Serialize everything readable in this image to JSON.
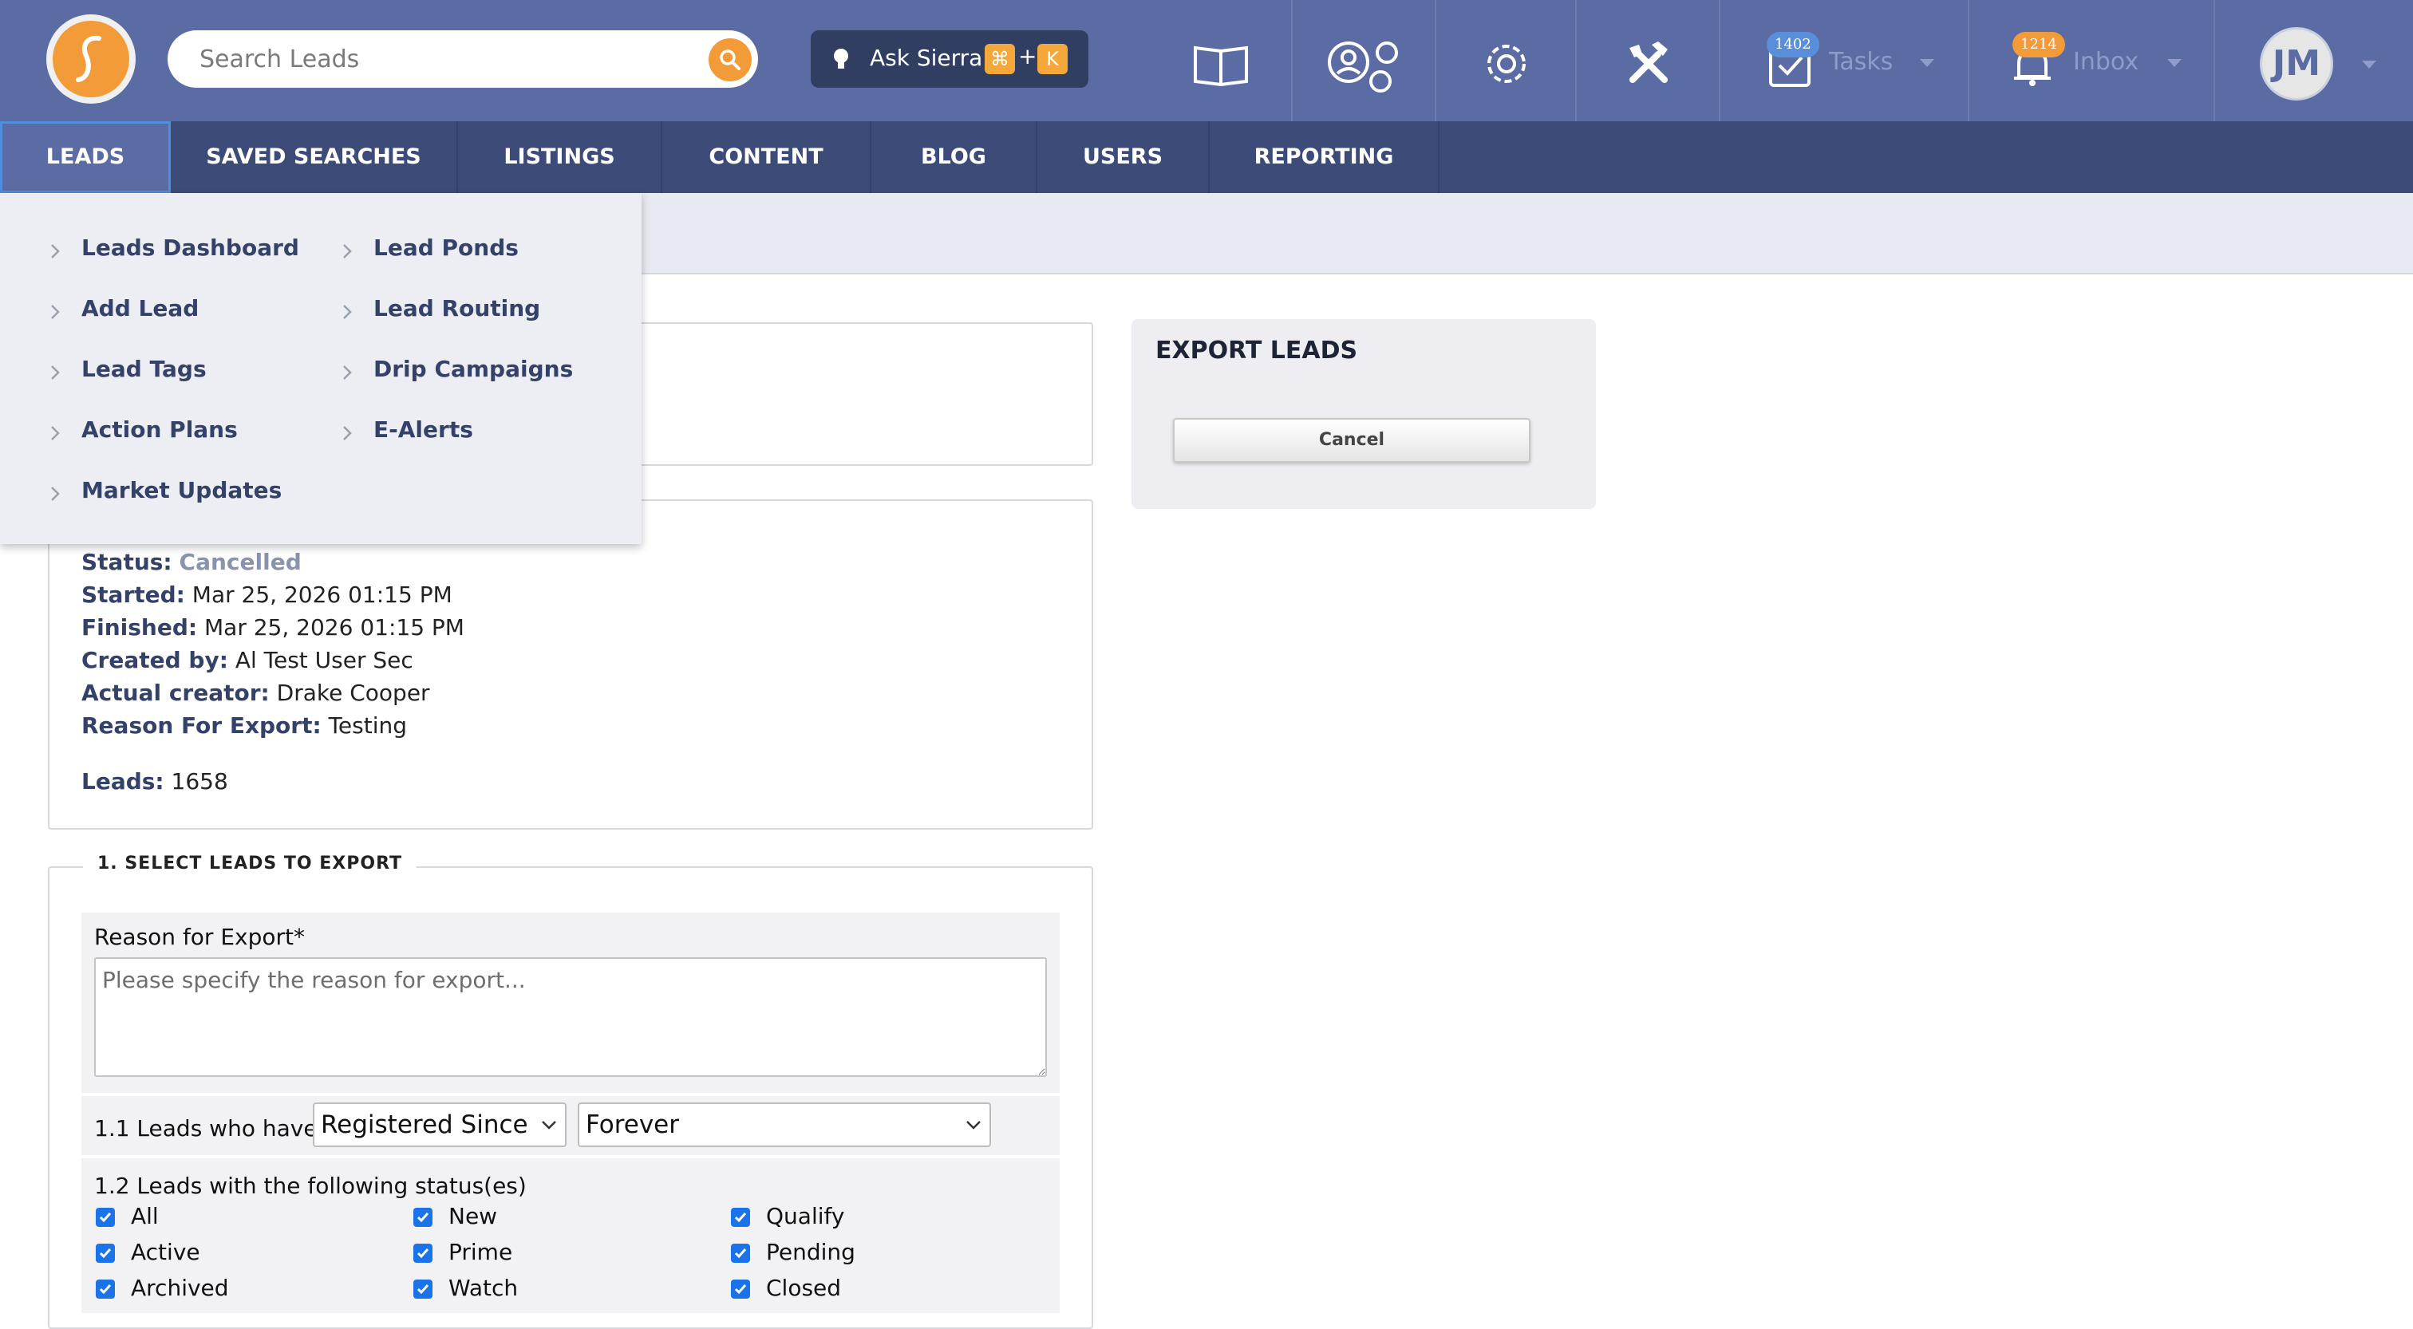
{
  "search": {
    "placeholder": "Search Leads"
  },
  "ask": {
    "label": "Ask Sierra",
    "shortcut_cmd": "⌘",
    "shortcut_plus": "+",
    "shortcut_key": "K"
  },
  "tasks": {
    "label": "Tasks",
    "count": "1402"
  },
  "inbox": {
    "label": "Inbox",
    "count": "1214"
  },
  "user": {
    "initials": "JM"
  },
  "nav": {
    "items": [
      {
        "label": "LEADS"
      },
      {
        "label": "SAVED SEARCHES"
      },
      {
        "label": "LISTINGS"
      },
      {
        "label": "CONTENT"
      },
      {
        "label": "BLOG"
      },
      {
        "label": "USERS"
      },
      {
        "label": "REPORTING"
      }
    ]
  },
  "leads_menu": {
    "col1": [
      "Leads Dashboard",
      "Add Lead",
      "Lead Tags",
      "Action Plans",
      "Market Updates"
    ],
    "col2": [
      "Lead Ponds",
      "Lead Routing",
      "Drip Campaigns",
      "E-Alerts"
    ]
  },
  "export_info": {
    "status_label": "Status:",
    "status_value": "Cancelled",
    "started_label": "Started:",
    "started_value": "Mar 25, 2026 01:15 PM",
    "finished_label": "Finished:",
    "finished_value": "Mar 25, 2026 01:15 PM",
    "created_label": "Created by:",
    "created_value": "Al Test User Sec",
    "creator_label": "Actual creator:",
    "creator_value": "Drake Cooper",
    "reason_label": "Reason For Export:",
    "reason_value": "Testing",
    "leads_label": "Leads:",
    "leads_value": "1658"
  },
  "export_panel": {
    "title": "EXPORT LEADS",
    "cancel_label": "Cancel"
  },
  "select_section": {
    "legend": "1. SELECT LEADS TO EXPORT",
    "reason_label": "Reason for Export*",
    "reason_placeholder": "Please specify the reason for export...",
    "row11_label": "1.1 Leads who have",
    "select1_value": "Registered Since",
    "select2_value": "Forever",
    "row12_label": "1.2 Leads with the following status(es)",
    "statuses": [
      {
        "label": "All",
        "checked": true
      },
      {
        "label": "New",
        "checked": true
      },
      {
        "label": "Qualify",
        "checked": true
      },
      {
        "label": "Active",
        "checked": true
      },
      {
        "label": "Prime",
        "checked": true
      },
      {
        "label": "Pending",
        "checked": true
      },
      {
        "label": "Archived",
        "checked": true
      },
      {
        "label": "Watch",
        "checked": true
      },
      {
        "label": "Closed",
        "checked": true
      }
    ]
  },
  "colors": {
    "topbar": "#5a6ca3",
    "navbar": "#3c4b78",
    "accent": "#f29b38",
    "link": "#34426a",
    "checkbox": "#1a73e8"
  }
}
